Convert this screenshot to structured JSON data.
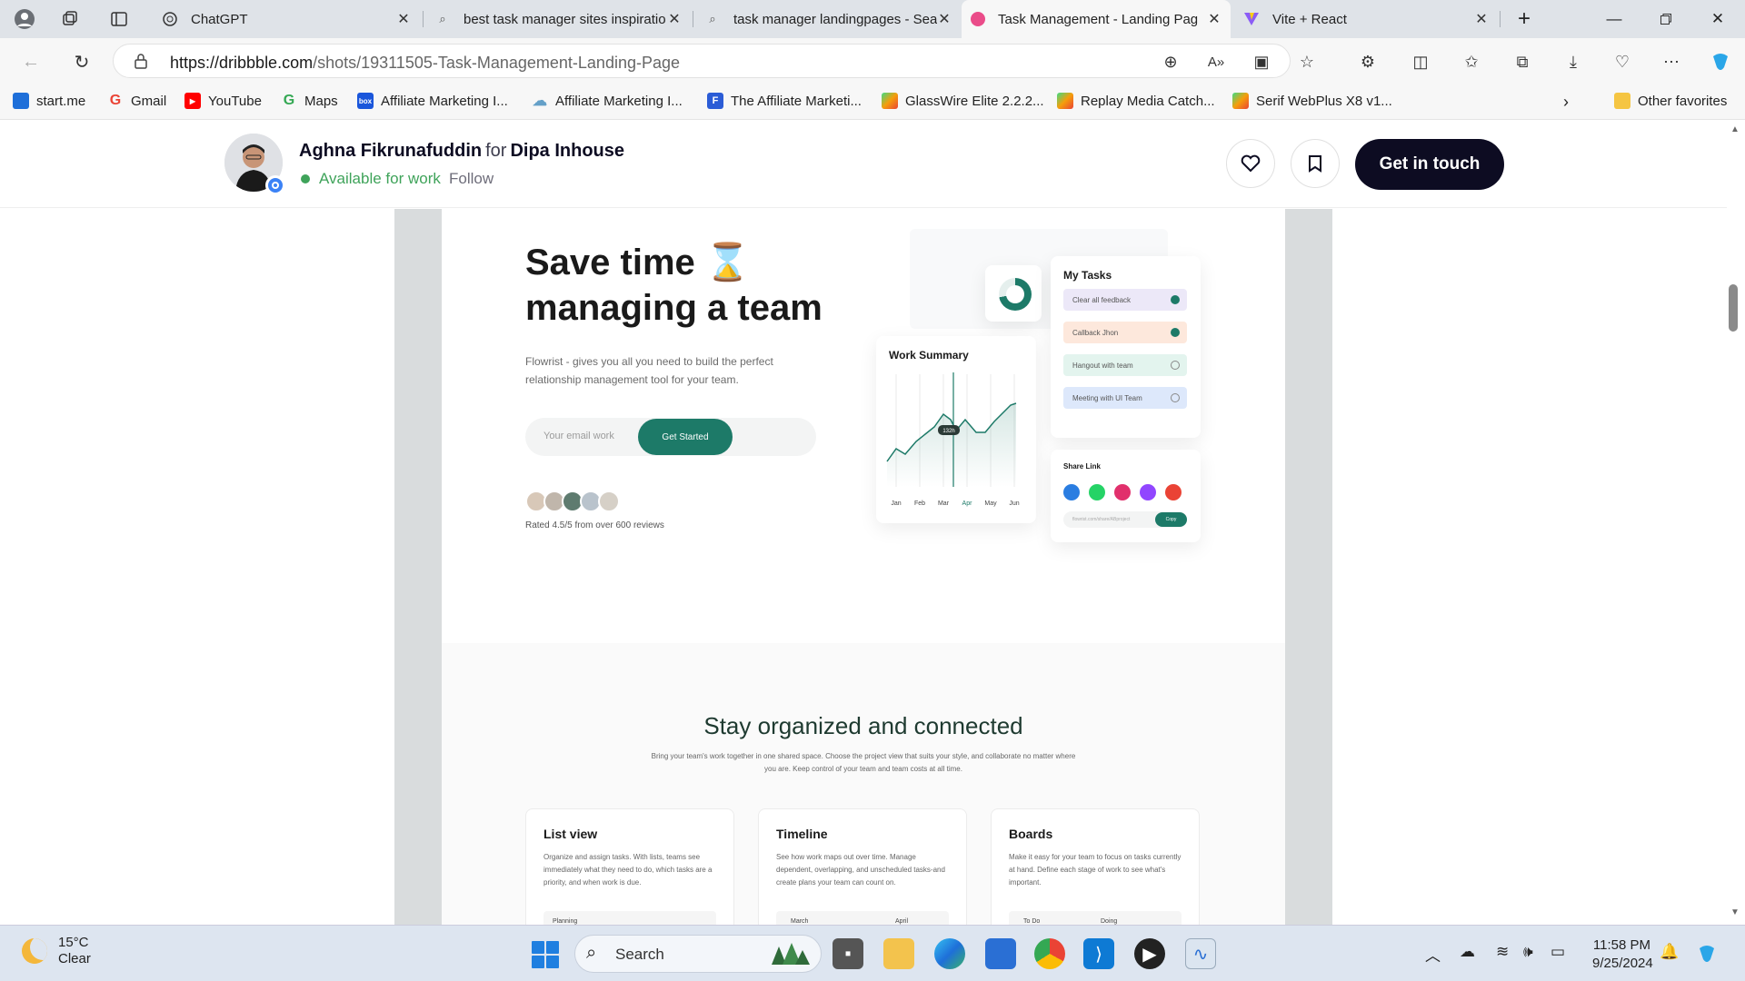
{
  "browser": {
    "tabs": [
      {
        "title": "ChatGPT",
        "icon": "chatgpt-icon"
      },
      {
        "title": "best task manager sites inspiratio",
        "icon": "search-icon"
      },
      {
        "title": "task manager landingpages - Sea",
        "icon": "search-icon"
      },
      {
        "title": "Task Management - Landing Pag",
        "icon": "dribbble-icon",
        "active": true
      },
      {
        "title": "Vite + React",
        "icon": "vite-icon"
      }
    ],
    "url_domain": "https://dribbble.com",
    "url_path": "/shots/19311505-Task-Management-Landing-Page",
    "bookmarks": [
      {
        "label": "start.me",
        "color": "#1e6fd9"
      },
      {
        "label": "Gmail",
        "color": "#ea4335"
      },
      {
        "label": "YouTube",
        "color": "#ff0000"
      },
      {
        "label": "Maps",
        "color": "#34a853"
      },
      {
        "label": "Affiliate Marketing I...",
        "color": "#1a56db"
      },
      {
        "label": "Affiliate Marketing I...",
        "color": "#64a0c8"
      },
      {
        "label": "The Affiliate Marketi...",
        "color": "#2b5cd6"
      },
      {
        "label": "GlassWire Elite 2.2.2...",
        "color": "#f59e0b"
      },
      {
        "label": "Replay Media Catch...",
        "color": "#f59e0b"
      },
      {
        "label": "Serif WebPlus X8 v1...",
        "color": "#f59e0b"
      }
    ],
    "other_favorites": "Other favorites"
  },
  "shot_header": {
    "author": "Aghna Fikrunafuddin",
    "for_word": "for",
    "team": "Dipa Inhouse",
    "availability": "Available for work",
    "follow": "Follow",
    "cta": "Get in touch"
  },
  "hero": {
    "headline_line1": "Save time ⌛",
    "headline_line2": "managing a team",
    "description": "Flowrist - gives you all you need to build the perfect relationship management tool for your team.",
    "email_placeholder": "Your email work",
    "cta": "Get Started",
    "rating": "Rated 4.5/5 from over 600 reviews",
    "work_summary_title": "Work Summary",
    "tooltip": "132h",
    "months": [
      "Jan",
      "Feb",
      "Mar",
      "Apr",
      "May",
      "Jun"
    ],
    "my_tasks_title": "My Tasks",
    "tasks": [
      {
        "label": "Clear all feedback",
        "bg": "#ece8f8",
        "done": true
      },
      {
        "label": "Callback Jhon",
        "bg": "#fde8dc",
        "done": true
      },
      {
        "label": "Hangout with team",
        "bg": "#e3f4ee",
        "done": false
      },
      {
        "label": "Meeting with UI Team",
        "bg": "#dde8fb",
        "done": false
      }
    ],
    "share_title": "Share Link",
    "share_colors": [
      "#2a7de1",
      "#25d366",
      "#e1306c",
      "#9146ff",
      "#ea4335"
    ],
    "share_url": "flowrist.com/share/ABproject",
    "copy": "Copy"
  },
  "section2": {
    "title": "Stay organized and connected",
    "description": "Bring your team's work together in one shared space. Choose the project view that suits your style, and collaborate no matter where you are. Keep control of your team and team costs at all time.",
    "cards": [
      {
        "title": "List view",
        "desc": "Organize and assign tasks. With lists, teams see immediately what they need to do, which tasks are a priority, and when work is due.",
        "sub1": "Planning",
        "sub2": ""
      },
      {
        "title": "Timeline",
        "desc": "See how work maps out over time. Manage dependent, overlapping, and unscheduled tasks-and create plans your team can count on.",
        "sub1": "March",
        "sub2": "April"
      },
      {
        "title": "Boards",
        "desc": "Make it easy for your team to focus on tasks currently at hand. Define each stage of work to see what's important.",
        "sub1": "To Do",
        "sub2": "Doing"
      }
    ]
  },
  "taskbar": {
    "temp": "15°C",
    "condition": "Clear",
    "search": "Search",
    "time": "11:58 PM",
    "date": "9/25/2024"
  }
}
